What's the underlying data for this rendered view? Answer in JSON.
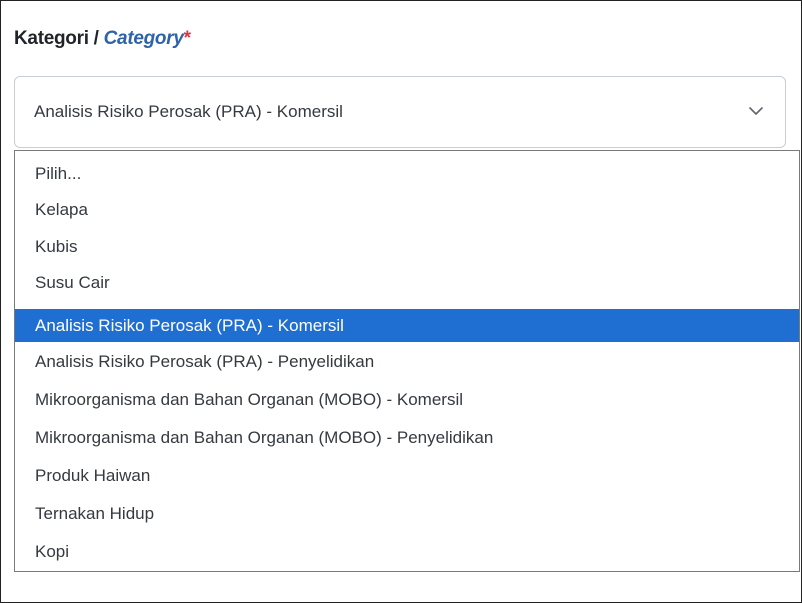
{
  "field": {
    "label_ms": "Kategori",
    "separator": "/",
    "label_en": "Category",
    "required_marker": "*"
  },
  "select": {
    "value": "Analisis Risiko Perosak (PRA) - Komersil",
    "icon": "chevron-down-icon"
  },
  "options": [
    "Pilih...",
    "Kelapa",
    "Kubis",
    "Susu Cair",
    "Analisis Risiko Perosak (PRA) - Komersil",
    "Analisis Risiko Perosak (PRA) - Penyelidikan",
    "Mikroorganisma dan Bahan Organan (MOBO) - Komersil",
    "Mikroorganisma dan Bahan Organan (MOBO) - Penyelidikan",
    "Produk Haiwan",
    "Ternakan Hidup",
    "Kopi"
  ],
  "selected_option": "Analisis Risiko Perosak (PRA) - Komersil",
  "colors": {
    "highlight": "#1f6fd2",
    "label_en": "#2f63a8",
    "required": "#dc3545"
  }
}
